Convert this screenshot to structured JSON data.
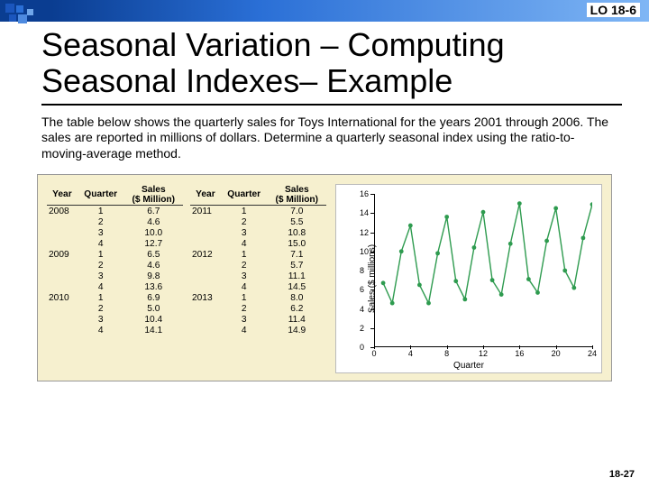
{
  "header": {
    "lo": "LO 18-6"
  },
  "title": "Seasonal Variation – Computing Seasonal Indexes– Example",
  "body": "The table below shows the quarterly sales for Toys International for the years 2001 through 2006.  The sales are reported in millions of dollars. Determine a quarterly seasonal index using the ratio-to-moving-average method.",
  "slide_number": "18-27",
  "table": {
    "col_headers": {
      "year": "Year",
      "quarter": "Quarter",
      "sales": "Sales\n($ Million)"
    },
    "left": [
      {
        "year": "2008",
        "rows": [
          [
            "1",
            "6.7"
          ],
          [
            "2",
            "4.6"
          ],
          [
            "3",
            "10.0"
          ],
          [
            "4",
            "12.7"
          ]
        ]
      },
      {
        "year": "2009",
        "rows": [
          [
            "1",
            "6.5"
          ],
          [
            "2",
            "4.6"
          ],
          [
            "3",
            "9.8"
          ],
          [
            "4",
            "13.6"
          ]
        ]
      },
      {
        "year": "2010",
        "rows": [
          [
            "1",
            "6.9"
          ],
          [
            "2",
            "5.0"
          ],
          [
            "3",
            "10.4"
          ],
          [
            "4",
            "14.1"
          ]
        ]
      }
    ],
    "right": [
      {
        "year": "2011",
        "rows": [
          [
            "1",
            "7.0"
          ],
          [
            "2",
            "5.5"
          ],
          [
            "3",
            "10.8"
          ],
          [
            "4",
            "15.0"
          ]
        ]
      },
      {
        "year": "2012",
        "rows": [
          [
            "1",
            "7.1"
          ],
          [
            "2",
            "5.7"
          ],
          [
            "3",
            "11.1"
          ],
          [
            "4",
            "14.5"
          ]
        ]
      },
      {
        "year": "2013",
        "rows": [
          [
            "1",
            "8.0"
          ],
          [
            "2",
            "6.2"
          ],
          [
            "3",
            "11.4"
          ],
          [
            "4",
            "14.9"
          ]
        ]
      }
    ]
  },
  "chart_data": {
    "type": "line",
    "xlabel": "Quarter",
    "ylabel": "Sales ($ millions)",
    "x": [
      1,
      2,
      3,
      4,
      5,
      6,
      7,
      8,
      9,
      10,
      11,
      12,
      13,
      14,
      15,
      16,
      17,
      18,
      19,
      20,
      21,
      22,
      23,
      24
    ],
    "values": [
      6.7,
      4.6,
      10.0,
      12.7,
      6.5,
      4.6,
      9.8,
      13.6,
      6.9,
      5.0,
      10.4,
      14.1,
      7.0,
      5.5,
      10.8,
      15.0,
      7.1,
      5.7,
      11.1,
      14.5,
      8.0,
      6.2,
      11.4,
      14.9
    ],
    "xticks": [
      0,
      4,
      8,
      12,
      16,
      20,
      24
    ],
    "yticks": [
      0,
      2,
      4,
      6,
      8,
      10,
      12,
      14,
      16
    ],
    "xlim": [
      0,
      24
    ],
    "ylim": [
      0,
      16
    ],
    "marker_color": "#2e9b4f",
    "line_color": "#2e9b4f"
  }
}
